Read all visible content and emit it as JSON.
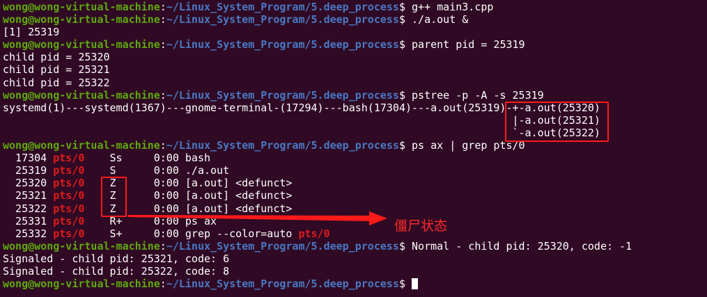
{
  "prompt": {
    "user_host": "wong@wong-virtual-machine",
    "colon": ":",
    "path": "~/Linux_System_Program/5.deep_process",
    "dollar": "$ "
  },
  "lines": [
    {
      "prompt": true,
      "cmd": "g++ main3.cpp"
    },
    {
      "prompt": true,
      "cmd": "./a.out &"
    },
    {
      "segments": [
        {
          "t": "[1] 25319"
        }
      ]
    },
    {
      "prompt": true,
      "cmd": "parent pid = 25319"
    },
    {
      "segments": [
        {
          "t": "child pid = 25320"
        }
      ]
    },
    {
      "segments": [
        {
          "t": "child pid = 25321"
        }
      ]
    },
    {
      "segments": [
        {
          "t": "child pid = 25322"
        }
      ]
    },
    {
      "prompt": true,
      "cmd": "pstree -p -A -s 25319"
    },
    {
      "segments": [
        {
          "t": "systemd(1)---systemd(1367)---gnome-terminal-(17294)---bash(17304)---a.out(25319)-+-a.out(25320)"
        }
      ]
    },
    {
      "segments": [
        {
          "t": "                                                                                 |-a.out(25321)"
        }
      ]
    },
    {
      "segments": [
        {
          "t": "                                                                                 `-a.out(25322)"
        }
      ]
    },
    {
      "prompt": true,
      "cmd": "ps ax | grep pts/0"
    },
    {
      "segments": [
        {
          "t": "  17304 "
        },
        {
          "t": "pts/0",
          "c": "red"
        },
        {
          "t": "    Ss     0:00 bash"
        }
      ]
    },
    {
      "segments": [
        {
          "t": "  25319 "
        },
        {
          "t": "pts/0",
          "c": "red"
        },
        {
          "t": "    S      0:00 ./a.out"
        }
      ]
    },
    {
      "segments": [
        {
          "t": "  25320 "
        },
        {
          "t": "pts/0",
          "c": "red"
        },
        {
          "t": "    Z      0:00 [a.out] <defunct>"
        }
      ]
    },
    {
      "segments": [
        {
          "t": "  25321 "
        },
        {
          "t": "pts/0",
          "c": "red"
        },
        {
          "t": "    Z      0:00 [a.out] <defunct>"
        }
      ]
    },
    {
      "segments": [
        {
          "t": "  25322 "
        },
        {
          "t": "pts/0",
          "c": "red"
        },
        {
          "t": "    Z      0:00 [a.out] <defunct>"
        }
      ]
    },
    {
      "segments": [
        {
          "t": "  25331 "
        },
        {
          "t": "pts/0",
          "c": "red"
        },
        {
          "t": "    R+     0:00 ps ax"
        }
      ]
    },
    {
      "segments": [
        {
          "t": "  25332 "
        },
        {
          "t": "pts/0",
          "c": "red"
        },
        {
          "t": "    S+     0:00 grep --color=auto "
        },
        {
          "t": "pts/0",
          "c": "red"
        }
      ]
    },
    {
      "prompt": true,
      "cmd": "Normal - child pid: 25320, code: -1"
    },
    {
      "segments": [
        {
          "t": "Signaled - child pid: 25321, code: 6"
        }
      ]
    },
    {
      "segments": [
        {
          "t": "Signaled - child pid: 25322, code: 8"
        }
      ]
    },
    {
      "prompt": true,
      "cmd": "",
      "cursor": true
    }
  ],
  "annotation": {
    "label": "僵尸状态",
    "color": "#ff1a1a"
  },
  "colors": {
    "background": "#300a24",
    "user_host": "#5fa80e",
    "path": "#4a78c4",
    "tty": "#e01b1b"
  }
}
